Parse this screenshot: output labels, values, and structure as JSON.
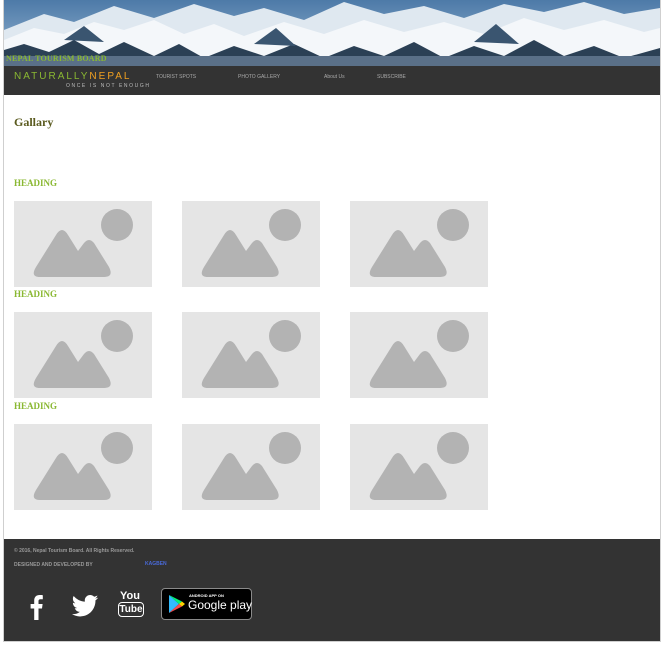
{
  "header": {
    "board_name": "NEPAL TOURISM BOARD",
    "logo": {
      "naturally": "NATURALLY",
      "nepal": "NEPAL",
      "tagline": "ONCE IS NOT ENOUGH"
    }
  },
  "nav": {
    "items": [
      {
        "label": "TOURIST SPOTS"
      },
      {
        "label": "PHOTO GALLERY"
      },
      {
        "label": "About Us"
      },
      {
        "label": "SUBSCRIBE"
      }
    ]
  },
  "main": {
    "title": "Gallary",
    "sections": [
      {
        "heading": "HEADING",
        "images": [
          "image-placeholder-icon",
          "image-placeholder-icon",
          "image-placeholder-icon"
        ]
      },
      {
        "heading": "HEADING",
        "images": [
          "image-placeholder-icon",
          "image-placeholder-icon",
          "image-placeholder-icon"
        ]
      },
      {
        "heading": "HEADING",
        "images": [
          "image-placeholder-icon",
          "image-placeholder-icon",
          "image-placeholder-icon"
        ]
      }
    ]
  },
  "footer": {
    "copyright": "© 2016, Nepal Tourism Board. All Rights Reserved.",
    "designed_by": "DESIGNED AND DEVELOPED BY",
    "designer": "KAGBEN",
    "social": [
      "facebook-icon",
      "twitter-icon",
      "youtube-icon"
    ],
    "youtube_text": {
      "top": "You",
      "bottom": "Tube"
    },
    "google_play": {
      "small": "ANDROID APP ON",
      "big": "Google play"
    }
  },
  "colors": {
    "accent_green": "#8ab832",
    "accent_orange": "#f0a020",
    "bar_dark": "#333333",
    "placeholder_bg": "#e5e5e5",
    "placeholder_fg": "#b3b3b3",
    "link_blue": "#4a6ad8"
  }
}
